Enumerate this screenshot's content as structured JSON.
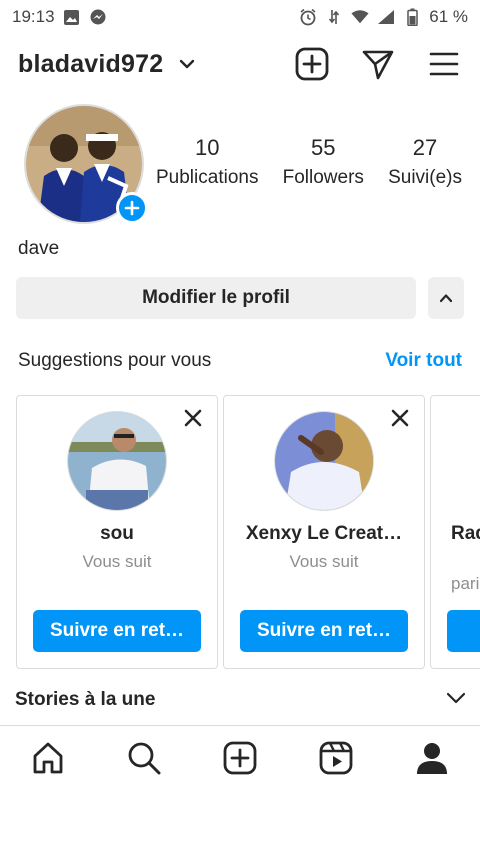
{
  "status_bar": {
    "time": "19:13",
    "battery": "61 %"
  },
  "header": {
    "username": "bladavid972"
  },
  "profile": {
    "display_name": "dave",
    "stats": [
      {
        "value": "10",
        "label": "Publications"
      },
      {
        "value": "55",
        "label": "Followers"
      },
      {
        "value": "27",
        "label": "Suivi(e)s"
      }
    ],
    "edit_label": "Modifier le profil"
  },
  "suggestions": {
    "title": "Suggestions pour vous",
    "see_all": "Voir tout",
    "cards": [
      {
        "name": "sou",
        "subtitle": "Vous suit",
        "button": "Suivre en ret…"
      },
      {
        "name": "Xenxy Le Creat…",
        "subtitle": "Vous suit",
        "button": "Suivre en ret…"
      },
      {
        "name": "Rad",
        "subtitle": "pari",
        "button": ""
      }
    ]
  },
  "stories": {
    "title": "Stories à la une"
  },
  "colors": {
    "accent": "#0095f6",
    "text": "#262626",
    "muted": "#8e8e8e",
    "button_bg": "#efefef"
  }
}
